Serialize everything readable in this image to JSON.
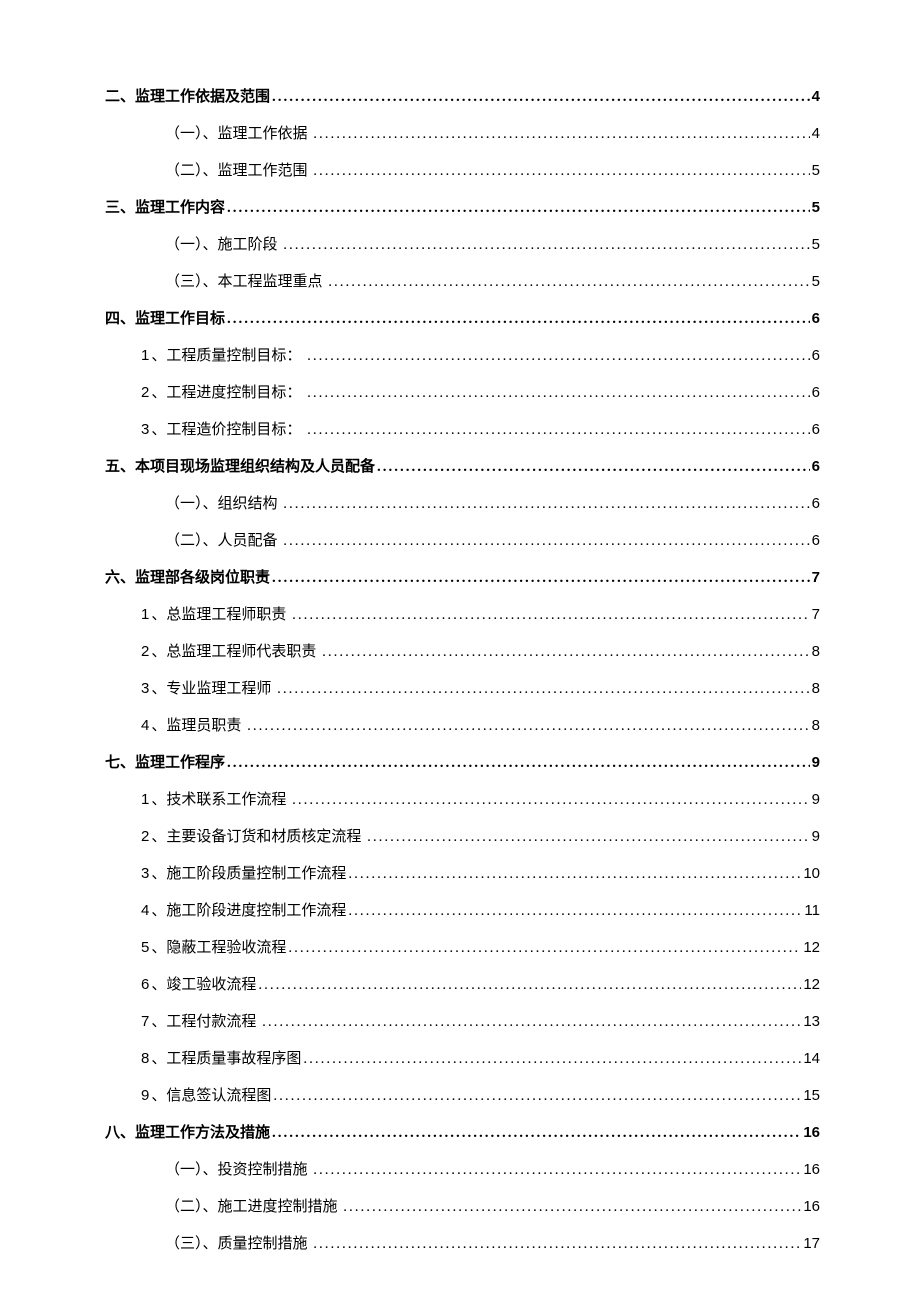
{
  "toc": [
    {
      "level": 1,
      "title": "二、监理工作依据及范围",
      "page": "4"
    },
    {
      "level": 3,
      "title": "（一）、监理工作依据",
      "page": "4",
      "trailing_space": true
    },
    {
      "level": 3,
      "title": "（二）、监理工作范围",
      "page": "5",
      "trailing_space": true
    },
    {
      "level": 1,
      "title": "三、监理工作内容",
      "page": "5"
    },
    {
      "level": 3,
      "title": "（一）、施工阶段",
      "page": "5",
      "trailing_space": true
    },
    {
      "level": 3,
      "title": "（三）、本工程监理重点",
      "page": "5",
      "trailing_space": true
    },
    {
      "level": 1,
      "title": "四、监理工作目标",
      "page": "6"
    },
    {
      "level": 2,
      "num": "1",
      "title": "、工程质量控制目标：",
      "page": "6",
      "trailing_space": true
    },
    {
      "level": 2,
      "num": "2",
      "title": "、工程进度控制目标：",
      "page": "6",
      "trailing_space": true
    },
    {
      "level": 2,
      "num": "3",
      "title": "、工程造价控制目标：",
      "page": "6",
      "trailing_space": true
    },
    {
      "level": 1,
      "title": "五、本项目现场监理组织结构及人员配备",
      "page": "6"
    },
    {
      "level": 3,
      "title": "（一）、组织结构",
      "page": "6",
      "trailing_space": true
    },
    {
      "level": 3,
      "title": "（二）、人员配备",
      "page": "6",
      "trailing_space": true
    },
    {
      "level": 1,
      "title": "六、监理部各级岗位职责",
      "page": "7"
    },
    {
      "level": 2,
      "num": "1",
      "title": "、总监理工程师职责",
      "page": "7",
      "trailing_space": true
    },
    {
      "level": 2,
      "num": "2",
      "title": "、总监理工程师代表职责",
      "page": "8",
      "trailing_space": true
    },
    {
      "level": 2,
      "num": "3",
      "title": "、专业监理工程师",
      "page": "8",
      "trailing_space": true
    },
    {
      "level": 2,
      "num": "4",
      "title": "、监理员职责",
      "page": "8",
      "trailing_space": true
    },
    {
      "level": 1,
      "title": "七、监理工作程序",
      "page": "9"
    },
    {
      "level": 2,
      "num": "1",
      "title": "、技术联系工作流程",
      "page": "9",
      "trailing_space": true
    },
    {
      "level": 2,
      "num": "2",
      "title": "、主要设备订货和材质核定流程",
      "page": "9",
      "trailing_space": true
    },
    {
      "level": 2,
      "num": "3",
      "title": "、施工阶段质量控制工作流程",
      "page": "10"
    },
    {
      "level": 2,
      "num": "4",
      "title": "、施工阶段进度控制工作流程",
      "page": "11"
    },
    {
      "level": 2,
      "num": "5",
      "title": "、隐蔽工程验收流程",
      "page": "12"
    },
    {
      "level": 2,
      "num": "6",
      "title": "、竣工验收流程",
      "page": "12"
    },
    {
      "level": 2,
      "num": "7",
      "title": "、工程付款流程",
      "page": "13",
      "trailing_space": true
    },
    {
      "level": 2,
      "num": "8",
      "title": "、工程质量事故程序图",
      "page": "14"
    },
    {
      "level": 2,
      "num": "9",
      "title": "、信息签认流程图",
      "page": "15"
    },
    {
      "level": 1,
      "title": "八、监理工作方法及措施",
      "page": "16"
    },
    {
      "level": 3,
      "title": "（一）、投资控制措施",
      "page": "16",
      "trailing_space": true
    },
    {
      "level": 3,
      "title": "（二）、施工进度控制措施",
      "page": "16",
      "trailing_space": true
    },
    {
      "level": 3,
      "title": "（三）、质量控制措施",
      "page": "17",
      "trailing_space": true
    }
  ]
}
